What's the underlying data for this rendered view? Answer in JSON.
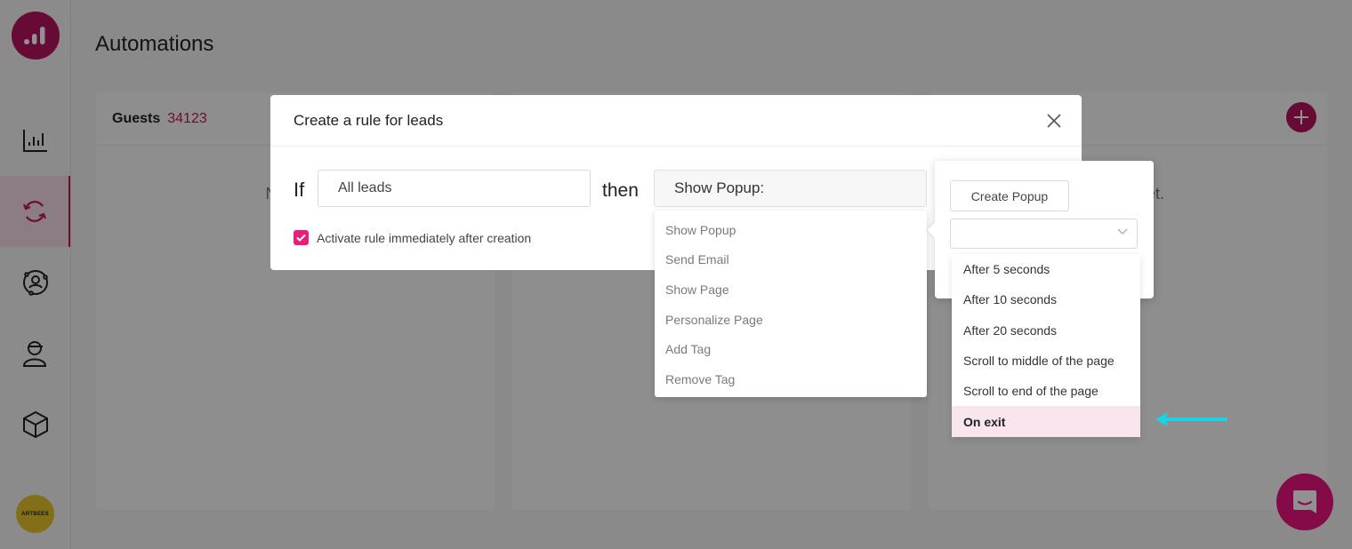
{
  "page": {
    "title": "Automations"
  },
  "colors": {
    "brand": "#b5125e",
    "accent": "#e91e78",
    "highlight": "#f8e5ee",
    "annotation_arrow": "#19d3e6"
  },
  "sidebar": {
    "items": [
      {
        "name": "analytics",
        "icon": "bar-chart-icon",
        "active": false
      },
      {
        "name": "automations",
        "icon": "sync-icon",
        "active": true
      },
      {
        "name": "audience",
        "icon": "user-orbit-icon",
        "active": false
      },
      {
        "name": "leads",
        "icon": "user-cap-icon",
        "active": false
      },
      {
        "name": "products",
        "icon": "cube-icon",
        "active": false
      }
    ],
    "avatar_label": "ARTBEES"
  },
  "columns": [
    {
      "name": "Guests",
      "count": "34123",
      "empty": "No rules"
    },
    {
      "name": "",
      "count": "",
      "empty": ""
    },
    {
      "name": "",
      "count": "",
      "empty": "t yet."
    }
  ],
  "modal": {
    "title": "Create a rule for leads",
    "if_label": "If",
    "condition_value": "All leads",
    "then_label": "then",
    "action_value": "Show Popup:",
    "activate_label": "Activate rule immediately after creation",
    "activate_checked": true
  },
  "action_options": [
    "Show Popup",
    "Send Email",
    "Show Page",
    "Personalize Page",
    "Add Tag",
    "Remove Tag"
  ],
  "popup_panel": {
    "create_button": "Create Popup",
    "trigger_value": ""
  },
  "trigger_options": [
    "After 5 seconds",
    "After 10 seconds",
    "After 20 seconds",
    "Scroll to middle of the page",
    "Scroll to end of the page",
    "On exit"
  ],
  "trigger_selected": "On exit"
}
